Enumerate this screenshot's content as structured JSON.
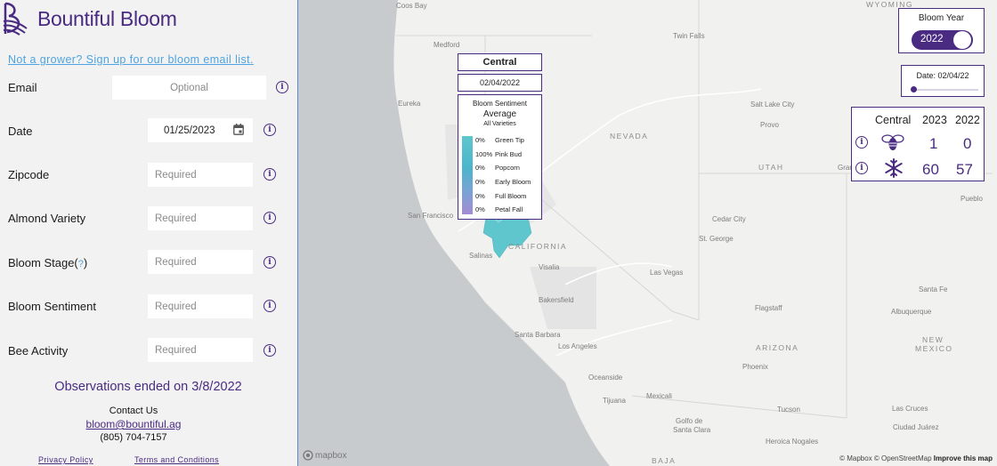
{
  "brand": {
    "name": "Bountiful Bloom"
  },
  "sidebar": {
    "signup_link": "Not a grower? Sign up for our bloom email list.",
    "fields": {
      "email": {
        "label": "Email",
        "placeholder": "Optional"
      },
      "date": {
        "label": "Date",
        "value": "01/25/2023"
      },
      "zipcode": {
        "label": "Zipcode",
        "placeholder": "Required"
      },
      "variety": {
        "label": "Almond Variety",
        "placeholder": "Required"
      },
      "stage": {
        "label": "Bloom Stage(",
        "help": "?",
        "label_end": ")",
        "placeholder": "Required"
      },
      "sentiment": {
        "label": "Bloom Sentiment",
        "placeholder": "Required"
      },
      "bee": {
        "label": "Bee Activity",
        "placeholder": "Required"
      }
    },
    "info_glyph": "i",
    "observations_ended": "Observations ended on 3/8/2022",
    "contact": {
      "title": "Contact Us",
      "email": "bloom@bountiful.ag",
      "phone": "(805) 704-7157"
    },
    "footer": {
      "privacy": "Privacy Policy",
      "terms": "Terms and Conditions"
    }
  },
  "map": {
    "tooltip": {
      "region": "Central",
      "date": "02/04/2022",
      "sentiment_title": "Bloom Sentiment",
      "sentiment_avg": "Average",
      "sentiment_scope": "All Varieties",
      "stages": [
        {
          "pct": "0%",
          "name": "Green Tip"
        },
        {
          "pct": "100%",
          "name": "Pink Bud"
        },
        {
          "pct": "0%",
          "name": "Popcorn"
        },
        {
          "pct": "0%",
          "name": "Early Bloom"
        },
        {
          "pct": "0%",
          "name": "Full Bloom"
        },
        {
          "pct": "0%",
          "name": "Petal Fall"
        }
      ]
    },
    "year_panel": {
      "label": "Bloom Year",
      "value": "2022",
      "toggle_on": true
    },
    "date_panel": {
      "label": "Date: 02/04/22",
      "slider_fraction": 0.02
    },
    "stats": {
      "region": "Central",
      "col_a": "2023",
      "col_b": "2022",
      "bee": {
        "icon": "bee-icon",
        "a": "1",
        "b": "0"
      },
      "frost": {
        "icon": "snowflake-icon",
        "a": "60",
        "b": "57"
      }
    },
    "labels": {
      "coos_bay": "Coos Bay",
      "medford": "Medford",
      "eureka": "Eureka",
      "twin_falls": "Twin Falls",
      "wyoming": "WYOMING",
      "nevada": "NEVADA",
      "salt_lake": "Salt Lake City",
      "provo": "Provo",
      "utah": "UTAH",
      "grand_junction": "Gran",
      "san_francisco": "San Francisco",
      "salinas": "Salinas",
      "california": "CALIFORNIA",
      "visalia": "Visalia",
      "bakersfield": "Bakersfield",
      "las_vegas": "Las Vegas",
      "st_george": "St. George",
      "cedar_city": "Cedar City",
      "santa_barbara": "Santa Barbara",
      "los_angeles": "Los Angeles",
      "oceanside": "Oceanside",
      "tijuana": "Tijuana",
      "mexicali": "Mexicali",
      "flagstaff": "Flagstaff",
      "arizona": "ARIZONA",
      "phoenix": "Phoenix",
      "tucson": "Tucson",
      "santa_fe": "Santa Fe",
      "albuquerque": "Albuquerque",
      "new": "NEW",
      "mexico": "MEXICO",
      "las_cruces": "Las Cruces",
      "ciudad_juarez": "Ciudad Juárez",
      "pueblo": "Pueblo",
      "hermosillo": "Heroica Nogales",
      "golfo": "Golfo de",
      "santa_clara": "Santa Clara",
      "baja": "BAJA"
    },
    "attribution": {
      "mapbox": "© Mapbox",
      "osm": "© OpenStreetMap",
      "improve": "Improve this map"
    },
    "mapbox_logo": "mapbox"
  },
  "colors": {
    "brand": "#4a2b82",
    "link": "#4fa3e0",
    "region_fill": "#5ec6cc"
  }
}
